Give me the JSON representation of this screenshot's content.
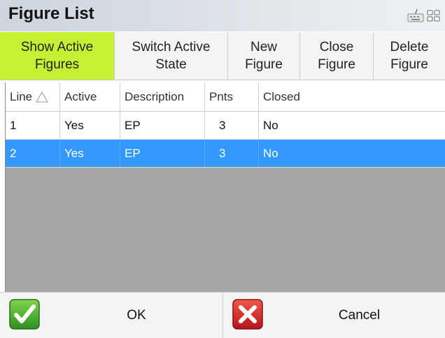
{
  "window": {
    "title": "Figure List"
  },
  "toolbar": {
    "buttons": [
      {
        "label": "Show Active\nFigures",
        "active": true
      },
      {
        "label": "Switch Active\nState",
        "active": false
      },
      {
        "label": "New\nFigure",
        "active": false
      },
      {
        "label": "Close\nFigure",
        "active": false
      },
      {
        "label": "Delete\nFigure",
        "active": false
      }
    ]
  },
  "table": {
    "columns": [
      "Line",
      "Active",
      "Description",
      "Pnts",
      "Closed"
    ],
    "rows": [
      {
        "line": "1",
        "active": "Yes",
        "description": "EP",
        "pnts": "3",
        "closed": "No",
        "selected": false
      },
      {
        "line": "2",
        "active": "Yes",
        "description": "EP",
        "pnts": "3",
        "closed": "No",
        "selected": true
      }
    ]
  },
  "footer": {
    "ok_label": "OK",
    "cancel_label": "Cancel"
  },
  "colors": {
    "active_button": "#c5f033",
    "selection": "#3399ff",
    "grid_empty": "#a6a6a6"
  },
  "icons": {
    "keyboard": "keyboard-icon",
    "window": "window-mode-icon",
    "sort": "sort-ascending-icon",
    "ok": "checkmark-icon",
    "cancel": "x-close-icon"
  }
}
